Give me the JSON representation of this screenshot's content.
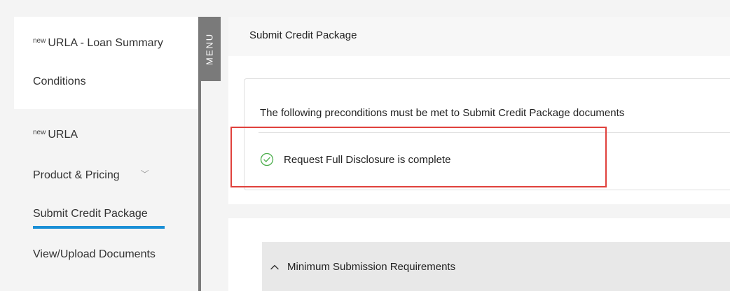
{
  "sidebar": {
    "top_items": [
      {
        "sup": "new",
        "label": "URLA - Loan Summary"
      },
      {
        "label": "Conditions"
      }
    ],
    "items": [
      {
        "sup": "new",
        "label": "URLA"
      },
      {
        "label": "Product & Pricing",
        "chevron": "﹀"
      },
      {
        "label": "Submit Credit Package"
      },
      {
        "label": "View/Upload Documents"
      }
    ]
  },
  "menu": {
    "label": "MENU"
  },
  "page": {
    "title": "Submit Credit Package"
  },
  "preconditions": {
    "intro": "The following preconditions must be met to Submit Credit Package documents",
    "items": [
      {
        "label": "Request Full Disclosure is complete",
        "icon": "check-circle-icon"
      }
    ]
  },
  "sections": [
    {
      "title": "Minimum Submission Requirements",
      "icon": "chevron-up-icon"
    }
  ],
  "colors": {
    "accent": "#1a8fd6",
    "check": "#4cae4c",
    "highlight": "#e0413c",
    "menu_tab": "#7a7a7a"
  }
}
